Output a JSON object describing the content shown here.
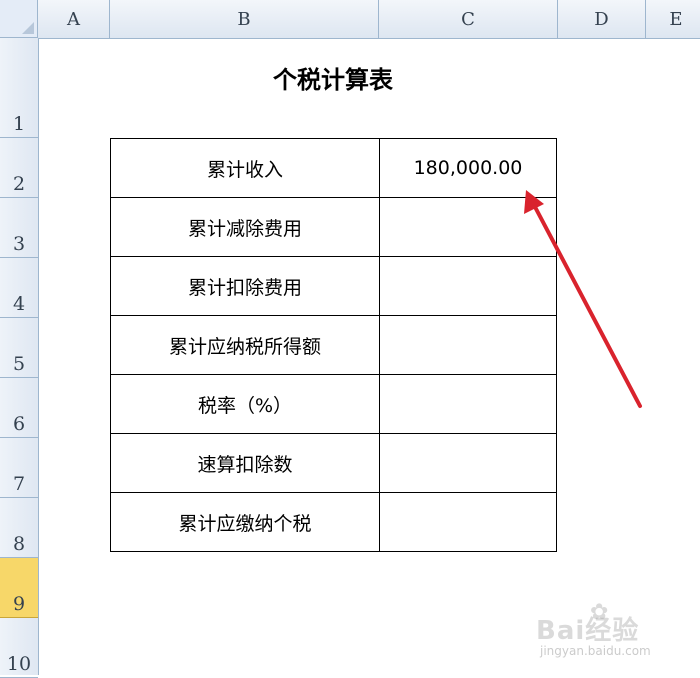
{
  "columns": [
    "A",
    "B",
    "C",
    "D",
    "E"
  ],
  "rows": [
    "1",
    "2",
    "3",
    "4",
    "5",
    "6",
    "7",
    "8",
    "9",
    "10"
  ],
  "selected_row": "9",
  "sheet": {
    "title": "个税计算表",
    "table": [
      {
        "label": "累计收入",
        "value": "180,000.00"
      },
      {
        "label": "累计减除费用",
        "value": ""
      },
      {
        "label": "累计扣除费用",
        "value": ""
      },
      {
        "label": "累计应纳税所得额",
        "value": ""
      },
      {
        "label": "税率（%）",
        "value": ""
      },
      {
        "label": "速算扣除数",
        "value": ""
      },
      {
        "label": "累计应缴纳个税",
        "value": ""
      }
    ]
  },
  "annotation": {
    "type": "red-arrow",
    "color": "#d9232d"
  },
  "watermark": {
    "logo": "Bai经验",
    "url": "jingyan.baidu.com"
  }
}
